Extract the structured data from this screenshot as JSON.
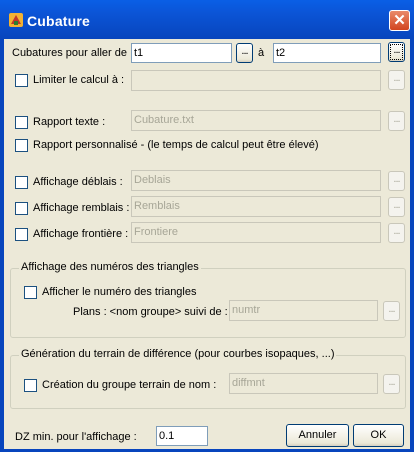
{
  "window": {
    "title": "Cubature",
    "close_glyph": "✕",
    "titlebar_color": "#0845bd"
  },
  "cubatures": {
    "label": "Cubatures pour aller de :",
    "from_value": "t1",
    "to_label": "à",
    "to_value": "t2"
  },
  "limiter": {
    "label": "Limiter le calcul à :",
    "value": "",
    "checked": false
  },
  "rapport_texte": {
    "label": "Rapport texte :",
    "value": "Cubature.txt",
    "checked": false
  },
  "rapport_perso": {
    "label": "Rapport personnalisé - (le temps de calcul peut être élevé)",
    "checked": false
  },
  "affichage_deblais": {
    "label": "Affichage déblais  :",
    "value": "Deblais",
    "checked": false
  },
  "affichage_remblais": {
    "label": "Affichage remblais :",
    "value": "Remblais",
    "checked": false
  },
  "affichage_frontiere": {
    "label": "Affichage frontière :",
    "value": "Frontiere",
    "checked": false
  },
  "triangles_group": {
    "title": "Affichage des numéros des triangles",
    "checkbox_label": "Afficher le numéro des triangles",
    "plans_label": "Plans : <nom groupe> suivi de :",
    "plans_value": "numtr"
  },
  "terrain_group": {
    "title": "Génération du terrain de différence (pour courbes isopaques, ...)",
    "checkbox_label": "Création du groupe terrain de nom :",
    "value": "diffmnt"
  },
  "dz": {
    "label": "DZ min. pour l'affichage :",
    "value": "0.1"
  },
  "buttons": {
    "browse": "...",
    "cancel": "Annuler",
    "ok": "OK"
  }
}
